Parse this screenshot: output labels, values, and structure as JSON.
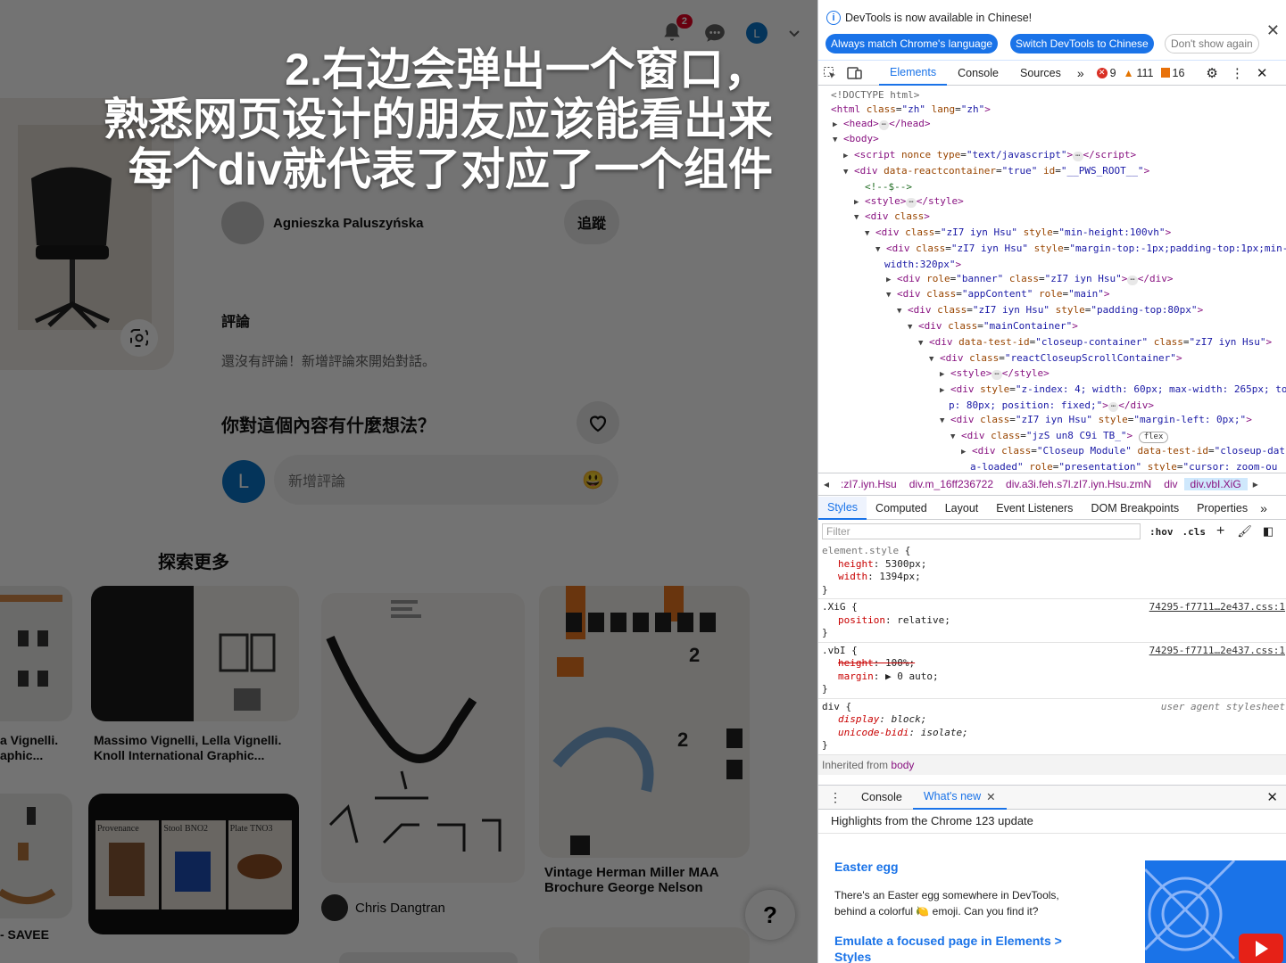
{
  "left_page": {
    "notification_count": "2",
    "user_initial": "L",
    "author_name": "Agnieszka Paluszyńska",
    "follow_label": "追蹤",
    "comments_title": "評論",
    "no_comments": "還沒有評論！新增評論來開始對話。",
    "question": "你對這個內容有什麼想法？",
    "me_initial": "L",
    "comment_placeholder": "新增評論",
    "explore_title": "探索更多",
    "pins": [
      {
        "caption_a": "a Vignelli.",
        "caption_b": "aphic..."
      },
      {
        "caption_a": "Massimo Vignelli, Lella Vignelli.",
        "caption_b": "Knoll International Graphic..."
      },
      {
        "caption_a": "Chris Dangtran"
      },
      {
        "caption_a": "Vintage Herman Miller MAA",
        "caption_b": "Brochure George Nelson"
      }
    ],
    "save_label": "- SAVEE",
    "card_labels": [
      "Provenance",
      "Stool BNO2",
      "Plate TNO3"
    ],
    "help_label": "?"
  },
  "caption": {
    "line1": "2.右边会弹出一个窗口，",
    "line2": "熟悉网页设计的朋友应该能看出来",
    "line3": "每个div就代表了对应了一个组件"
  },
  "devtools": {
    "info_text": "DevTools is now available in Chinese!",
    "btn_match": "Always match Chrome's language",
    "btn_switch": "Switch DevTools to Chinese",
    "btn_dont": "Don't show again",
    "tabs": [
      "Elements",
      "Console",
      "Sources"
    ],
    "errors": "9",
    "warnings": "111",
    "issues": "16",
    "breadcrumbs": [
      ":zI7.iyn.Hsu",
      "div.m_16ff236722",
      "div.a3i.feh.s7l.zI7.iyn.Hsu.zmN",
      "div",
      "div.vbI.XiG"
    ],
    "subtabs": [
      "Styles",
      "Computed",
      "Layout",
      "Event Listeners",
      "DOM Breakpoints",
      "Properties"
    ],
    "filter_placeholder": "Filter",
    "hov": ":hov",
    "cls": ".cls",
    "inherited_label": "Inherited from",
    "inherited_from": "body",
    "src_file": "74295-f7711…2e437.css:1",
    "ua_label": "user agent stylesheet",
    "drawer_tabs": [
      "Console",
      "What's new"
    ],
    "highlights": "Highlights from the Chrome 123 update",
    "egg_title": "Easter egg",
    "egg_text": "There's an Easter egg somewhere in DevTools, behind a colorful 🍋 emoji. Can you find it?",
    "emulate_title": "Emulate a focused page in Elements > Styles"
  }
}
